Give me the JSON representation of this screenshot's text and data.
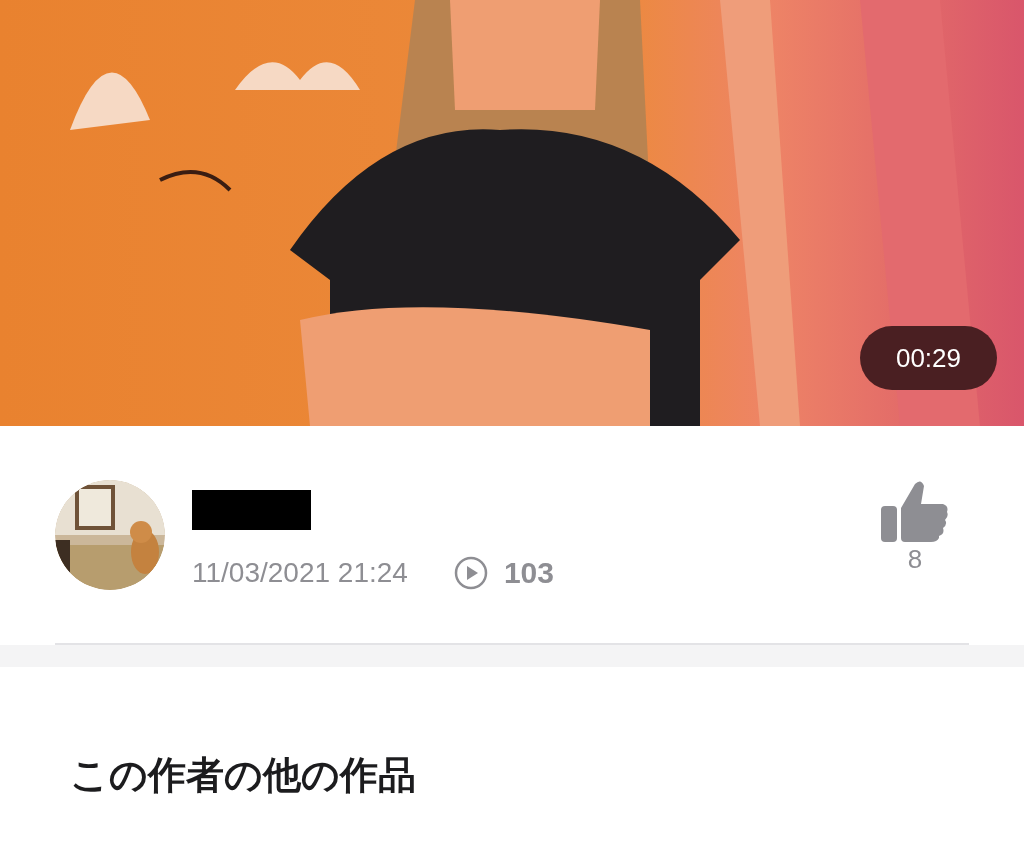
{
  "video": {
    "kind": "picture",
    "duration": "00:29"
  },
  "author": {
    "name_redacted": true,
    "posted_at": "11/03/2021 21:24",
    "play_count": "103",
    "like_count": "8"
  },
  "section": {
    "title": "この作者の他の作品"
  }
}
